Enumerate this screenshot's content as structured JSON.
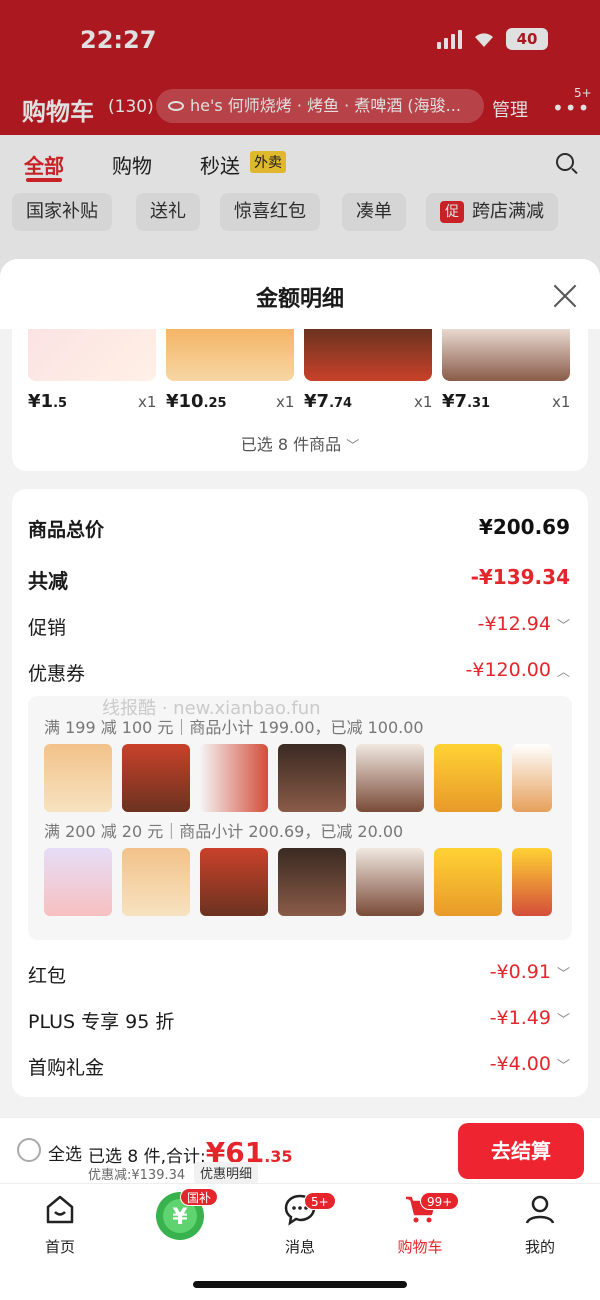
{
  "status": {
    "time": "22:27",
    "battery": "40"
  },
  "header": {
    "title": "购物车",
    "count": "(130)",
    "search_text": "he's 何师烧烤 · 烤鱼 · 煮啤酒 (海骏...",
    "manage": "管理",
    "more_badge": "5+"
  },
  "tabs": [
    {
      "label": "全部"
    },
    {
      "label": "购物"
    },
    {
      "label": "秒送"
    }
  ],
  "waimai_badge": "外卖",
  "chips": [
    "国家补贴",
    "送礼",
    "惊喜红包",
    "凑单",
    "跨店满减"
  ],
  "chip_cu": "促",
  "sheet": {
    "title": "金额明细",
    "products": [
      {
        "price_main": "¥1",
        "price_dec": ".5",
        "qty": "x1"
      },
      {
        "price_main": "¥10",
        "price_dec": ".25",
        "qty": "x1"
      },
      {
        "price_main": "¥7",
        "price_dec": ".74",
        "qty": "x1"
      },
      {
        "price_main": "¥7",
        "price_dec": ".31",
        "qty": "x1"
      }
    ],
    "selected_count": "已选 8 件商品",
    "rows": {
      "subtotal_label": "商品总价",
      "subtotal_value": "¥200.69",
      "total_reduce_label": "共减",
      "total_reduce_value": "-¥139.34",
      "promo_label": "促销",
      "promo_value": "-¥12.94",
      "coupon_label": "优惠券",
      "coupon_value": "-¥120.00",
      "redpacket_label": "红包",
      "redpacket_value": "-¥0.91",
      "plus_label": "PLUS 专享 95 折",
      "plus_value": "-¥1.49",
      "firstbuy_label": "首购礼金",
      "firstbuy_value": "-¥4.00"
    },
    "coupon_groups": [
      {
        "text": "满 199 减 100 元｜商品小计 199.00，已减 100.00"
      },
      {
        "text": "满 200 减 20 元｜商品小计 200.69，已减 20.00"
      }
    ],
    "watermark": "线报酷 · new.xianbao.fun"
  },
  "checkout": {
    "select_all": "全选",
    "summary_prefix": "已选 8 件,合计:",
    "total_main": "¥61",
    "total_dec": ".35",
    "discount": "优惠减:¥139.34",
    "detail": "优惠明细",
    "button": "去结算"
  },
  "tabbar": [
    {
      "label": "首页"
    },
    {
      "label": "国补"
    },
    {
      "label": "消息",
      "badge": "5+"
    },
    {
      "label": "购物车",
      "badge": "99+"
    },
    {
      "label": "我的"
    }
  ],
  "colors": {
    "brand_red": "#e4262c",
    "header_red": "#c41c24"
  }
}
